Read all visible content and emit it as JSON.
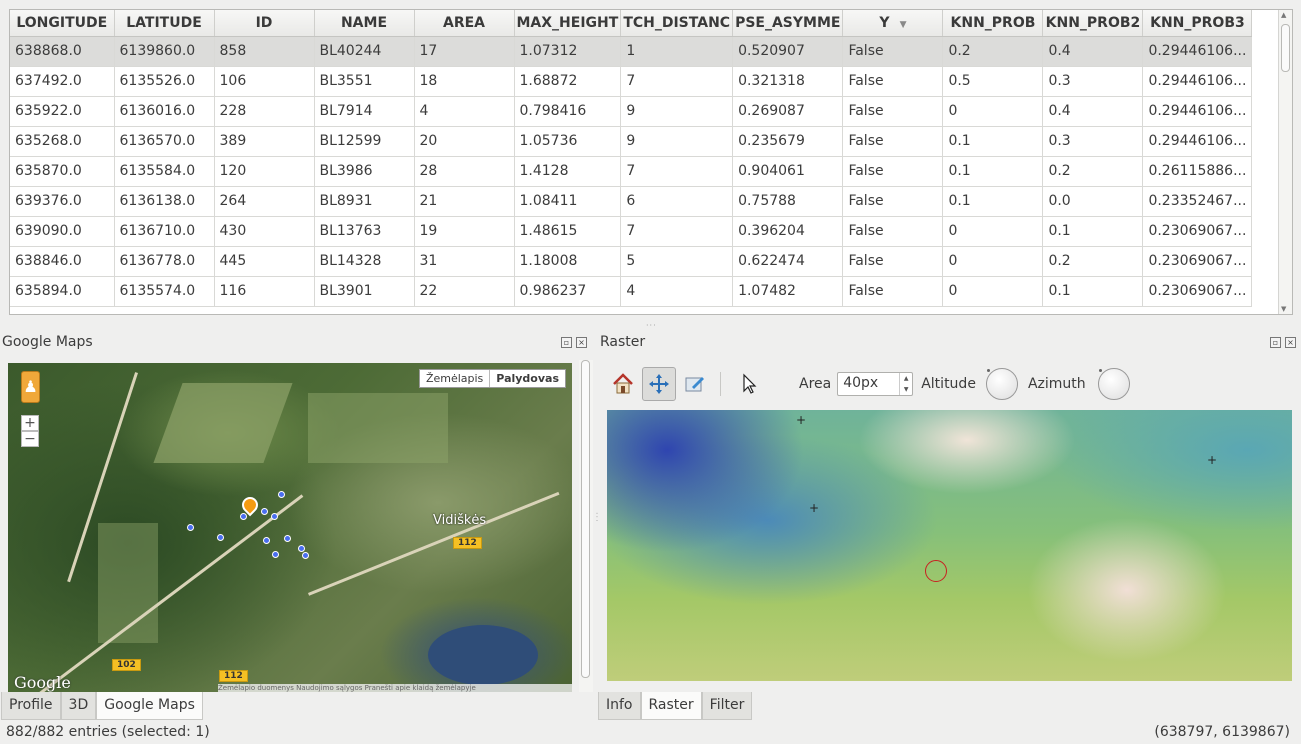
{
  "table": {
    "columns": [
      "LONGITUDE",
      "LATITUDE",
      "ID",
      "NAME",
      "AREA",
      "MAX_HEIGHT",
      "TCH_DISTANC",
      "PSE_ASYMME",
      "Y",
      "KNN_PROB",
      "KNN_PROB2",
      "KNN_PROB3"
    ],
    "sorted_column": "Y",
    "selected_row": 0,
    "rows": [
      [
        "638868.0",
        "6139860.0",
        "858",
        "BL40244",
        "17",
        "1.07312",
        "1",
        "0.520907",
        "False",
        "0.2",
        "0.4",
        "0.29446106..."
      ],
      [
        "637492.0",
        "6135526.0",
        "106",
        "BL3551",
        "18",
        "1.68872",
        "7",
        "0.321318",
        "False",
        "0.5",
        "0.3",
        "0.29446106..."
      ],
      [
        "635922.0",
        "6136016.0",
        "228",
        "BL7914",
        "4",
        "0.798416",
        "9",
        "0.269087",
        "False",
        "0",
        "0.4",
        "0.29446106..."
      ],
      [
        "635268.0",
        "6136570.0",
        "389",
        "BL12599",
        "20",
        "1.05736",
        "9",
        "0.235679",
        "False",
        "0.1",
        "0.3",
        "0.29446106..."
      ],
      [
        "635870.0",
        "6135584.0",
        "120",
        "BL3986",
        "28",
        "1.4128",
        "7",
        "0.904061",
        "False",
        "0.1",
        "0.2",
        "0.26115886..."
      ],
      [
        "639376.0",
        "6136138.0",
        "264",
        "BL8931",
        "21",
        "1.08411",
        "6",
        "0.75788",
        "False",
        "0.1",
        "0.0",
        "0.23352467..."
      ],
      [
        "639090.0",
        "6136710.0",
        "430",
        "BL13763",
        "19",
        "1.48615",
        "7",
        "0.396204",
        "False",
        "0",
        "0.1",
        "0.23069067..."
      ],
      [
        "638846.0",
        "6136778.0",
        "445",
        "BL14328",
        "31",
        "1.18008",
        "5",
        "0.622474",
        "False",
        "0",
        "0.2",
        "0.23069067..."
      ],
      [
        "635894.0",
        "6135574.0",
        "116",
        "BL3901",
        "22",
        "0.986237",
        "4",
        "1.07482",
        "False",
        "0",
        "0.1",
        "0.23069067..."
      ]
    ]
  },
  "maps_panel": {
    "title": "Google Maps",
    "map_type_options": [
      "Žemėlapis",
      "Palydovas"
    ],
    "map_type_selected": "Palydovas",
    "place_label": "Vidiškės",
    "route_labels": [
      "112",
      "102",
      "112"
    ],
    "logo": "Google",
    "footer_text": "Žemėlapio duomenys   Naudojimo sąlygos   Pranešti apie klaidą žemėlapyje",
    "zoom_in": "+",
    "zoom_out": "−"
  },
  "raster_panel": {
    "title": "Raster",
    "area_label": "Area",
    "area_value": "40px",
    "altitude_label": "Altitude",
    "azimuth_label": "Azimuth"
  },
  "left_tabs": [
    "Profile",
    "3D",
    "Google Maps"
  ],
  "left_tab_active": "Google Maps",
  "right_tabs": [
    "Info",
    "Raster",
    "Filter"
  ],
  "right_tab_active": "Raster",
  "status": {
    "entries": "882/882 entries (selected: 1)",
    "coordinates": "(638797, 6139867)"
  },
  "icons": {
    "home": "home-icon",
    "pan": "pan-icon",
    "edit": "edit-icon",
    "cursor": "cursor-icon",
    "pegman": "pegman-icon",
    "restore": "restore-icon",
    "close": "close-icon"
  },
  "colors": {
    "selected_row": "#dcdcda",
    "map_pin_orange": "#f59b12",
    "map_pin_blue": "#4a6ef0",
    "route_shield": "#f5c024",
    "raster_marker": "#c82020"
  }
}
